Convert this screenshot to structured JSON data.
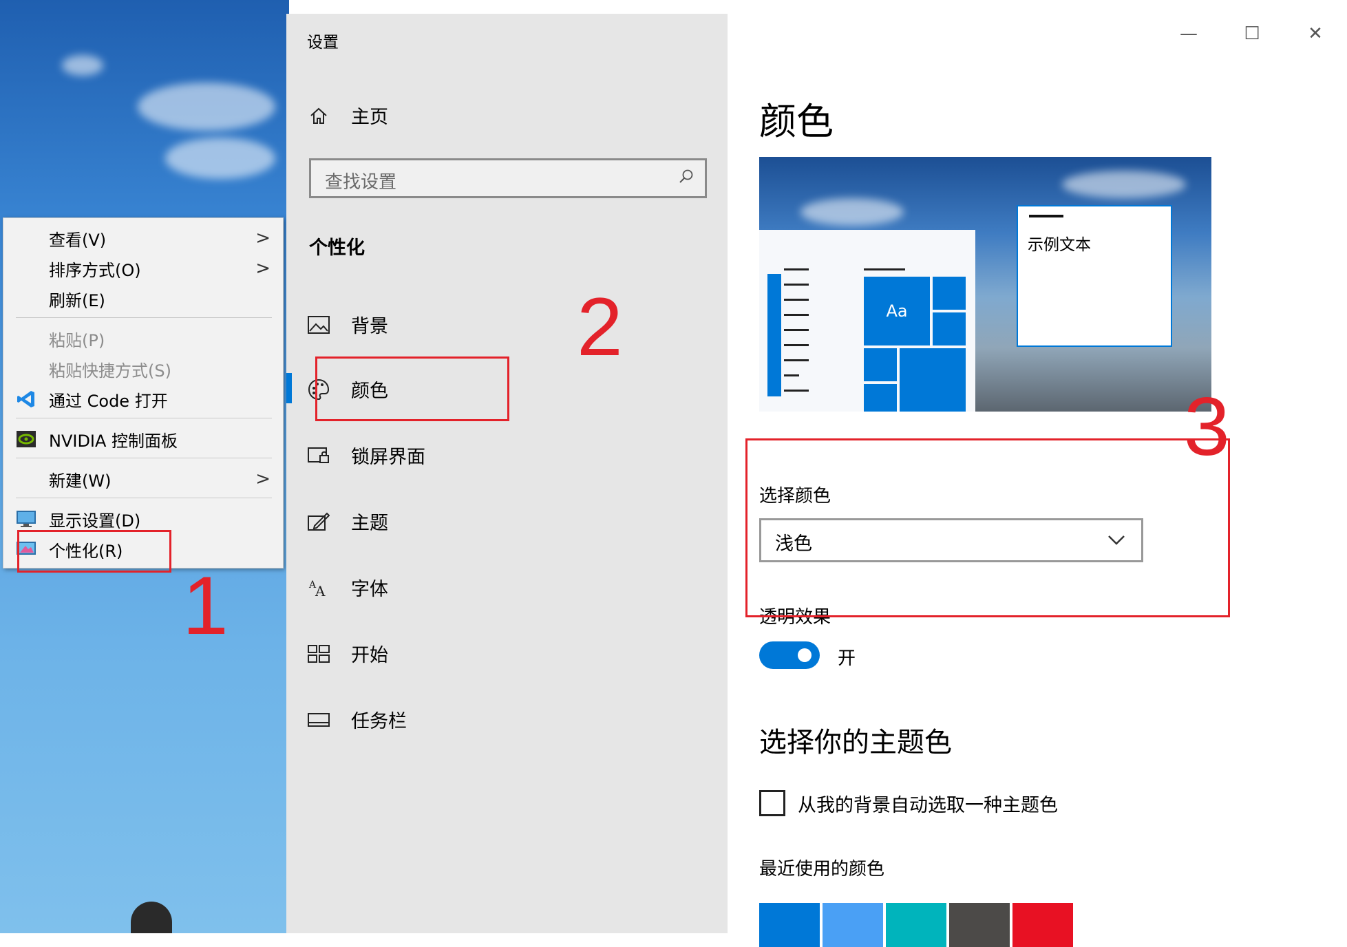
{
  "context_menu": {
    "items": [
      {
        "label": "查看(V)",
        "submenu": true
      },
      {
        "label": "排序方式(O)",
        "submenu": true
      },
      {
        "label": "刷新(E)"
      },
      {
        "label": "粘贴(P)",
        "disabled": true
      },
      {
        "label": "粘贴快捷方式(S)",
        "disabled": true
      },
      {
        "label": "通过 Code 打开",
        "icon": "vscode-icon"
      },
      {
        "label": "NVIDIA 控制面板",
        "icon": "nvidia-icon"
      },
      {
        "label": "新建(W)",
        "submenu": true
      },
      {
        "label": "显示设置(D)",
        "icon": "display-icon"
      },
      {
        "label": "个性化(R)",
        "icon": "personalize-icon"
      }
    ]
  },
  "settings": {
    "app_title": "设置",
    "home_label": "主页",
    "search_placeholder": "查找设置",
    "section": "个性化",
    "nav_items": [
      {
        "label": "背景",
        "icon": "picture-icon"
      },
      {
        "label": "颜色",
        "icon": "palette-icon",
        "selected": true
      },
      {
        "label": "锁屏界面",
        "icon": "lock-screen-icon"
      },
      {
        "label": "主题",
        "icon": "theme-icon"
      },
      {
        "label": "字体",
        "icon": "font-icon"
      },
      {
        "label": "开始",
        "icon": "start-icon"
      },
      {
        "label": "任务栏",
        "icon": "taskbar-icon"
      }
    ],
    "window_buttons": {
      "minimize": "—",
      "maximize": "☐",
      "close": "✕"
    }
  },
  "colors_page": {
    "title": "颜色",
    "preview_sample_text": "示例文本",
    "preview_tile_text": "Aa",
    "choose_color_label": "选择颜色",
    "choose_color_value": "浅色",
    "transparency_label": "透明效果",
    "transparency_state": "开",
    "accent_heading": "选择你的主题色",
    "auto_accent_label": "从我的背景自动选取一种主题色",
    "recent_colors_label": "最近使用的颜色",
    "recent_colors": [
      "#0078d7",
      "#4aa0f5",
      "#00b4bc",
      "#4c4a48",
      "#e81123"
    ]
  },
  "annotations": [
    "1",
    "2",
    "3"
  ],
  "accent_color": "#0078d7"
}
